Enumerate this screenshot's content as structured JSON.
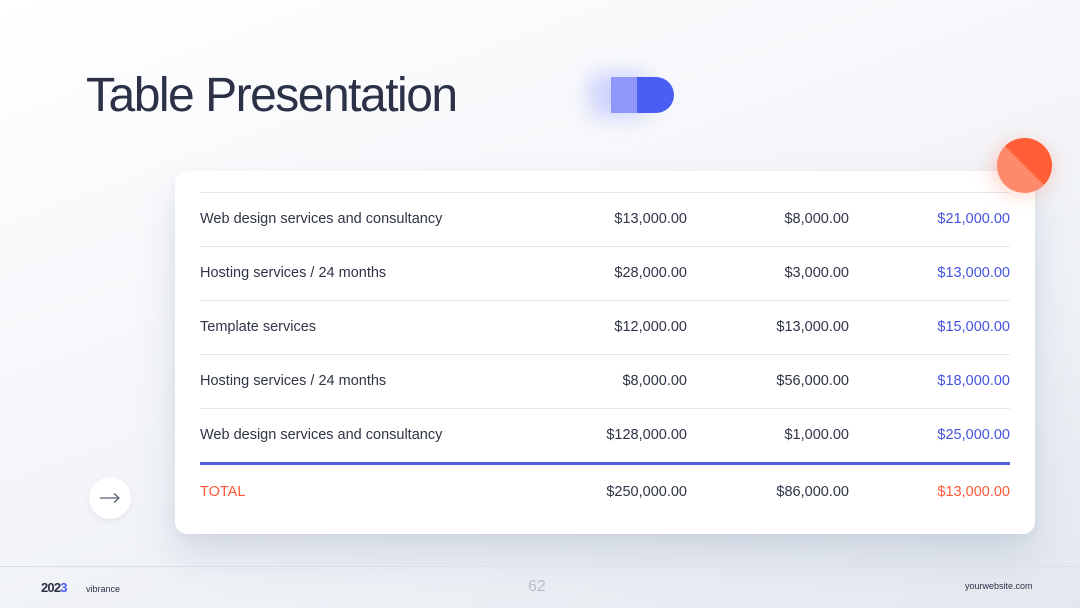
{
  "slide": {
    "title": "Table Presentation",
    "page_number": "62",
    "footer_year_prefix": "202",
    "footer_year_suffix": "3",
    "footer_brand": "vibrance",
    "website": "yourwebsite.com"
  },
  "table": {
    "rows": [
      {
        "label": "Web design services and consultancy",
        "v1": "$13,000.00",
        "v2": "$8,000.00",
        "v3": "$21,000.00"
      },
      {
        "label": "Hosting services / 24 months",
        "v1": "$28,000.00",
        "v2": "$3,000.00",
        "v3": "$13,000.00"
      },
      {
        "label": "Template services",
        "v1": "$12,000.00",
        "v2": "$13,000.00",
        "v3": "$15,000.00"
      },
      {
        "label": "Hosting services / 24 months",
        "v1": "$8,000.00",
        "v2": "$56,000.00",
        "v3": "$18,000.00"
      },
      {
        "label": "Web design services and consultancy",
        "v1": "$128,000.00",
        "v2": "$1,000.00",
        "v3": "$25,000.00"
      }
    ],
    "total": {
      "label": "TOTAL",
      "v1": "$250,000.00",
      "v2": "$86,000.00",
      "v3": "$13,000.00"
    }
  },
  "icons": {
    "arrow": "arrow-right-icon",
    "pill": "pill-decoration-icon",
    "circle": "circle-decoration-icon"
  },
  "colors": {
    "accent_blue": "#4a5ef3",
    "accent_orange": "#ff5a35",
    "title": "#2b3147"
  }
}
